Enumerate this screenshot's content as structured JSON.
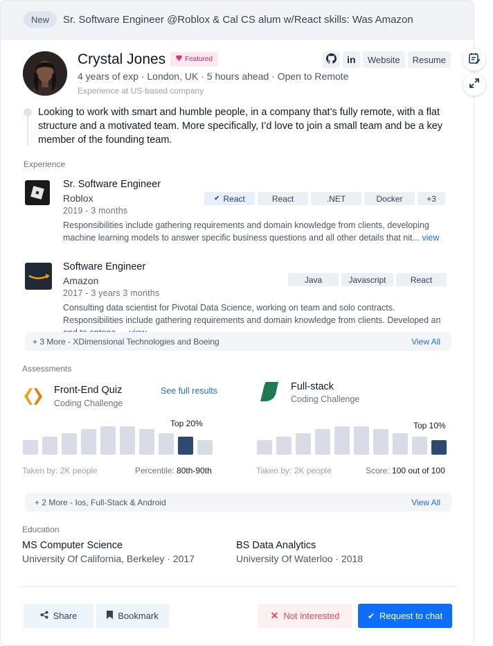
{
  "header": {
    "badge": "New",
    "headline": "Sr. Software Engineer @Roblox & Cal CS alum w/React skills: Was Amazon"
  },
  "profile": {
    "name": "Crystal Jones",
    "featured_label": "Featured",
    "meta": "4 years of exp · London, UK · 5 hours ahead · Open to Remote",
    "meta_secondary": "Experience at US-based company",
    "links": {
      "website": "Website",
      "resume": "Resume"
    },
    "quote": "Looking to work with smart and humble people, in a company that’s fully remote, with a flat structure and a motivated team. More specifically, I’d love to join a small team and be a key member of the founding team."
  },
  "experience": {
    "label": "Experience",
    "jobs": [
      {
        "title": "Sr. Software Engineer",
        "company": "Roblox",
        "duration": "2019 - 3 months",
        "description": "Responsibilities include gathering requirements and domain knowledge from clients, developing machine learning models to answer specific business questions and all other details that nit...",
        "view": "view",
        "tags": [
          "React",
          "React",
          ".NET",
          "Docker",
          "+3"
        ]
      },
      {
        "title": "Software Engineer",
        "company": "Amazon",
        "duration": "2017 - 3 years 3 months",
        "description": "Consulting data scientist for Pivotal Data Science, working on team and solo contracts. Responsibilities include gathering requirements and domain knowledge from clients. Developed an end to entonc...",
        "view": "view",
        "tags": [
          "Java",
          "Javascript",
          "React"
        ]
      }
    ],
    "more": "+ 3 More -  XDimensional Technologies and Boeing",
    "view_all": "View All"
  },
  "assessments": {
    "label": "Assessments",
    "items": [
      {
        "title": "Front-End Quiz",
        "subtitle": "Coding Challenge",
        "link": "See full results",
        "top": "Top 20%",
        "taken": "Taken by:  2K people",
        "result_label": "Percentile: ",
        "result_value": "80th-90th",
        "distribution": [
          0.42,
          0.52,
          0.62,
          0.73,
          0.82,
          0.82,
          0.73,
          0.62,
          0.52,
          0.42
        ],
        "highlight_index": 8,
        "logo_color": "#f0a020"
      },
      {
        "title": "Full-stack",
        "subtitle": "Coding Challenge",
        "link": "",
        "top": "Top 10%",
        "taken": "Taken by:  2K people",
        "result_label": "Score: ",
        "result_value": "100 out of 100",
        "distribution": [
          0.42,
          0.52,
          0.62,
          0.73,
          0.82,
          0.82,
          0.73,
          0.62,
          0.52,
          0.42
        ],
        "highlight_index": 9,
        "logo_color": "#1d7a55"
      }
    ],
    "more": "+ 2 More -  Ios, Full-Stack & Android",
    "view_all": "View All"
  },
  "education": {
    "label": "Education",
    "items": [
      {
        "degree": "MS Computer Science",
        "school": "University Of California, Berkeley · 2017"
      },
      {
        "degree": "BS Data Analytics",
        "school": "University Of Waterloo · 2018"
      }
    ]
  },
  "actions": {
    "share": "Share",
    "bookmark": "Bookmark",
    "not_interested": "Not interested",
    "request_chat": "Request to chat"
  },
  "colors": {
    "accent": "#0d6efd",
    "link": "#1d6fe0",
    "highlight_bar": "#2e4a73",
    "danger": "#e0485a"
  }
}
